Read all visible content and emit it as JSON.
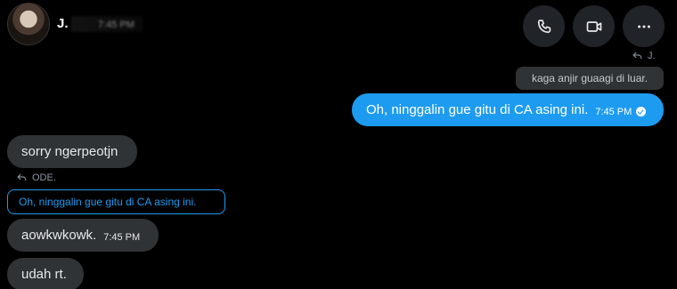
{
  "header": {
    "name": "J.",
    "time": "7:45 PM",
    "buttons": {
      "call": "phone-icon",
      "video": "video-icon",
      "more": "more-icon"
    }
  },
  "messages": {
    "reply_to_top": "J.",
    "quoted_top": "kaga anjir guaagi di luar.",
    "sent_text": "Oh, ninggalin gue gitu di CA asing ini.",
    "sent_time": "7:45 PM",
    "recv1_text": "sorry ngerpeotjn",
    "reply_to_bottom": "ODE.",
    "quoted_bottom": "Oh, ninggalin gue gitu di CA asing ini.",
    "recv2_text": "aowkwkowk.",
    "recv2_time": "7:45 PM",
    "recv3_text": "udah rt."
  },
  "colors": {
    "accent": "#1d9bf0",
    "bubble_received": "#2f3336",
    "background": "#000000"
  }
}
